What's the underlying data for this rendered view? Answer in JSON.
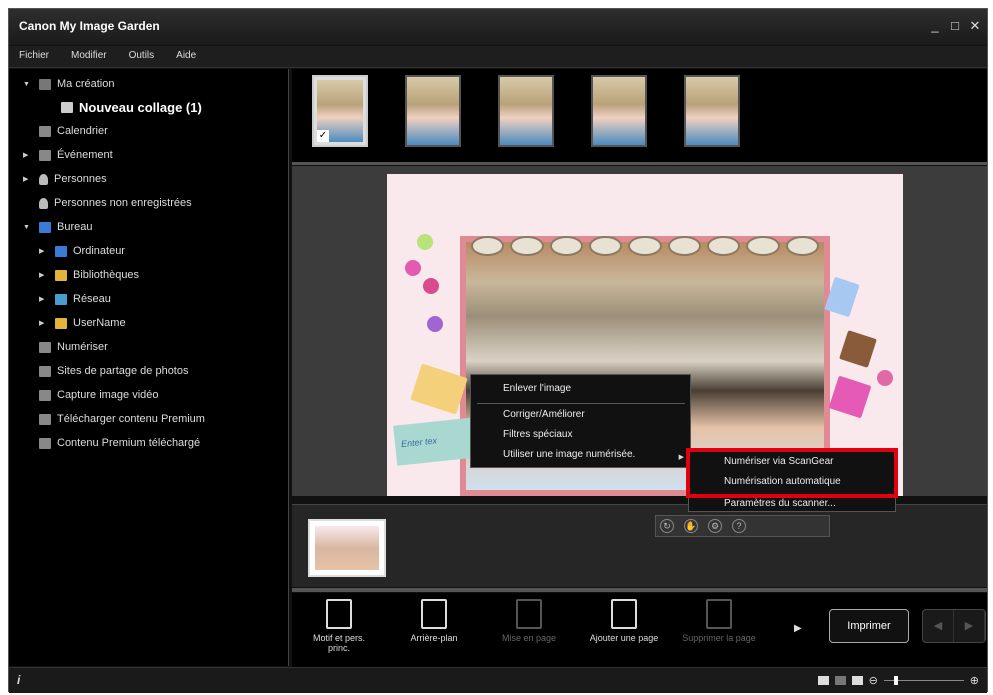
{
  "window": {
    "title": "Canon My Image Garden",
    "controls": [
      "_",
      "□",
      "✕"
    ]
  },
  "menu": [
    "Fichier",
    "Modifier",
    "Outils",
    "Aide"
  ],
  "sidebar": {
    "items": [
      {
        "label": "Ma création",
        "arrow": "▼",
        "icon": "creation-icon"
      },
      {
        "label": "Nouveau collage (1)",
        "icon": "collage-icon"
      },
      {
        "label": "Calendrier",
        "icon": "calendar-icon"
      },
      {
        "label": "Événement",
        "arrow": "▶",
        "icon": "event-icon"
      },
      {
        "label": "Personnes",
        "arrow": "▶",
        "icon": "person-icon"
      },
      {
        "label": "Personnes non enregistrées",
        "icon": "person-icon"
      },
      {
        "label": "Bureau",
        "arrow": "▼",
        "icon": "desktop-icon"
      },
      {
        "label": "Ordinateur",
        "arrow": "▶",
        "icon": "computer-icon"
      },
      {
        "label": "Bibliothèques",
        "arrow": "▶",
        "icon": "library-icon"
      },
      {
        "label": "Réseau",
        "arrow": "▶",
        "icon": "network-icon"
      },
      {
        "label": "UserName",
        "arrow": "▶",
        "icon": "user-folder-icon"
      },
      {
        "label": "Numériser",
        "icon": "scan-icon"
      },
      {
        "label": "Sites de partage de photos",
        "icon": "photo-share-icon"
      },
      {
        "label": "Capture image vidéo",
        "icon": "video-capture-icon"
      },
      {
        "label": "Télécharger contenu Premium",
        "icon": "premium-download-icon"
      },
      {
        "label": "Contenu Premium téléchargé",
        "icon": "premium-folder-icon"
      }
    ]
  },
  "canvas": {
    "text_box_placeholder": "Enter tex"
  },
  "context_menu": {
    "items": [
      "Enlever l'image",
      "Corriger/Améliorer",
      "Filtres spéciaux",
      "Utiliser une image numérisée."
    ]
  },
  "submenu": {
    "items": [
      "Numériser via ScanGear",
      "Numérisation automatique",
      "Paramètres du scanner..."
    ]
  },
  "bottom_toolbar": {
    "buttons": [
      {
        "label": "Motif et pers. princ.",
        "enabled": true
      },
      {
        "label": "Arrière-plan",
        "enabled": true
      },
      {
        "label": "Mise en page",
        "enabled": false
      },
      {
        "label": "Ajouter une page",
        "enabled": true
      },
      {
        "label": "Supprimer la page",
        "enabled": false
      }
    ],
    "print_label": "Imprimer"
  },
  "statusbar": {
    "info_icon": "i"
  },
  "colors": {
    "highlight": "#e00010",
    "background": "#111111",
    "canvas_bg": "#3c3c3c"
  }
}
